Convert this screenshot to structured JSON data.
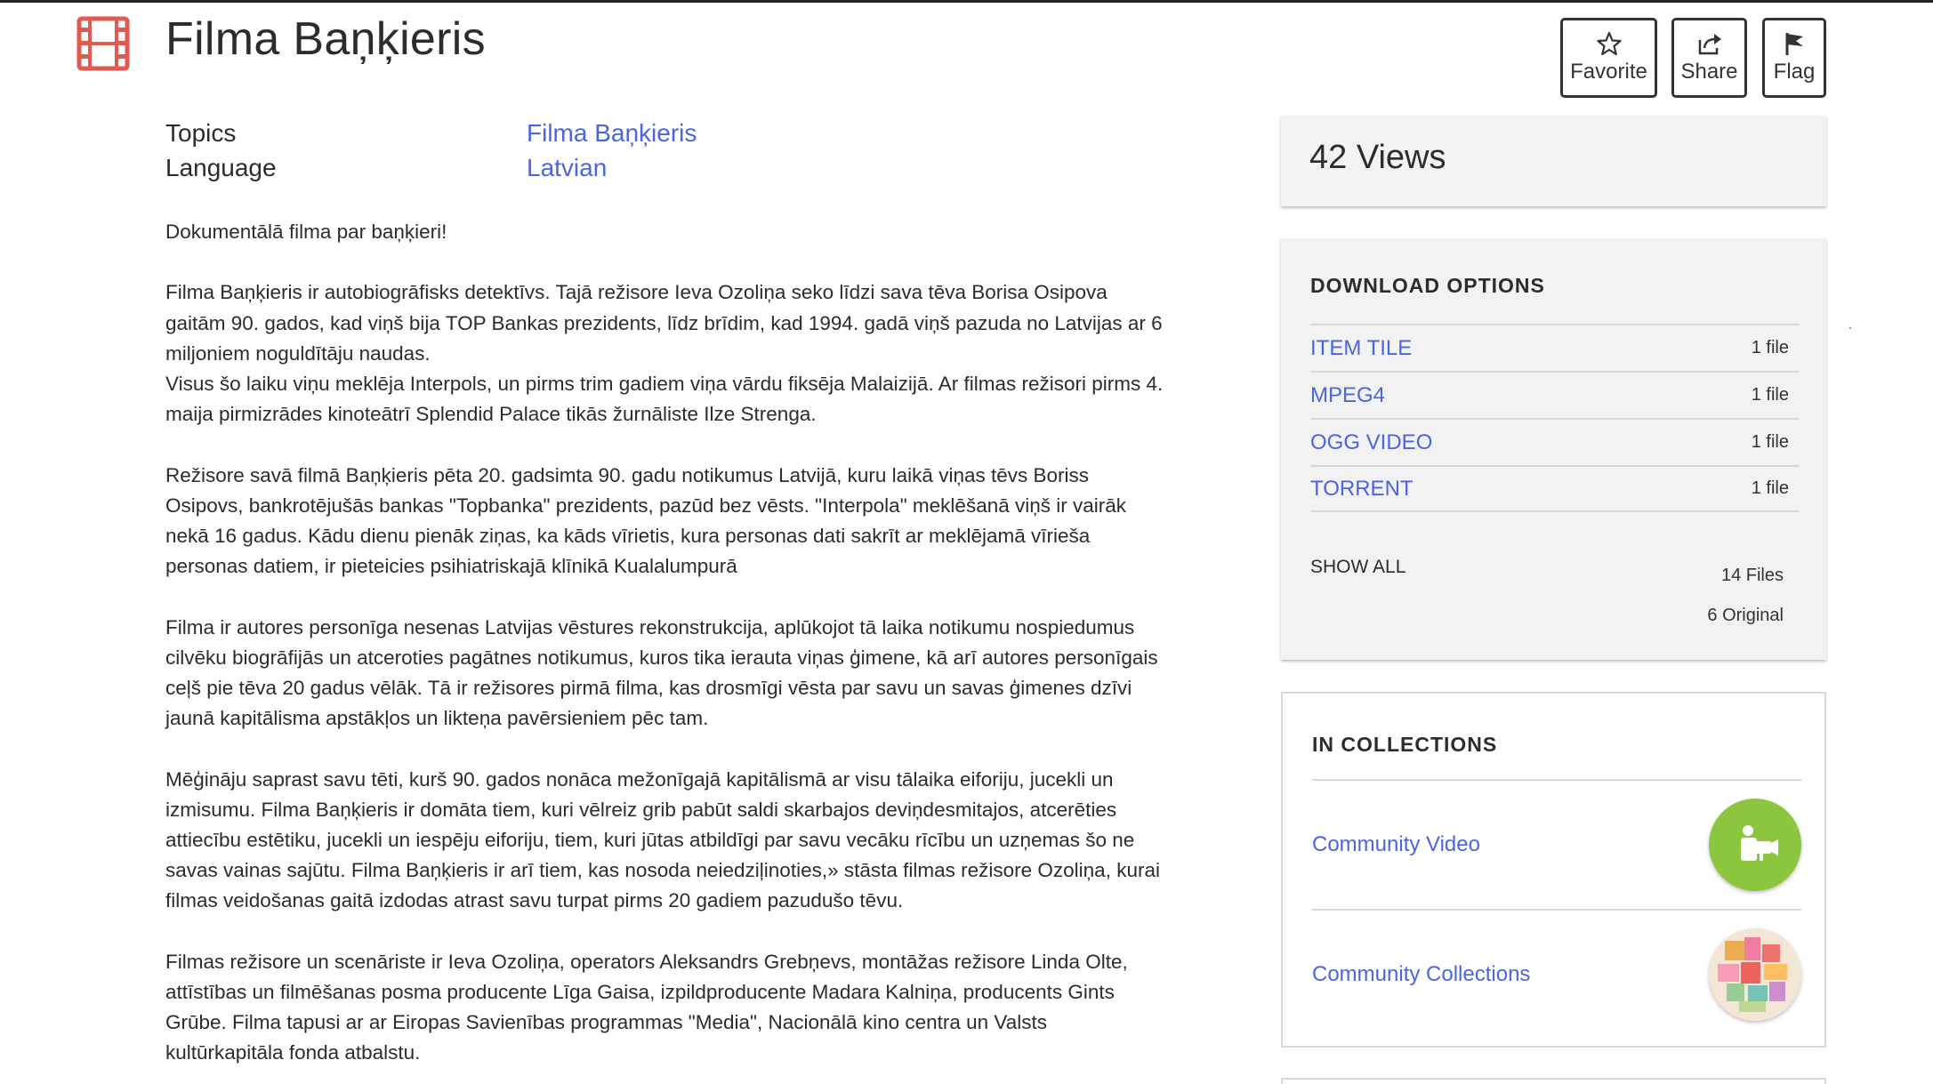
{
  "item": {
    "title": "Filma Baņķieris",
    "media_icon": "film-icon",
    "accent_color": "#e05a4f"
  },
  "actions": {
    "favorite_label": "Favorite",
    "share_label": "Share",
    "flag_label": "Flag"
  },
  "metadata": [
    {
      "key": "Topics",
      "value": "Filma Baņķieris"
    },
    {
      "key": "Language",
      "value": "Latvian"
    }
  ],
  "description": [
    "Dokumentālā filma par baņķieri!",
    "Filma Baņķieris ir autobiogrāfisks detektīvs. Tajā režisore Ieva Ozoliņa seko līdzi sava tēva Borisa Osipova\ngaitām 90. gados, kad viņš bija TOP Bankas prezidents, līdz brīdim, kad 1994. gadā viņš pazuda no Latvijas ar 6\nmiljoniem noguldītāju naudas.\nVisus šo laiku viņu meklēja Interpols, un pirms trim gadiem viņa vārdu fiksēja Malaizijā. Ar filmas režisori pirms 4.\nmaija pirmizrādes kinoteātrī Splendid Palace tikās žurnāliste Ilze Strenga.",
    "Režisore savā filmā Baņķieris pēta 20. gadsimta 90. gadu notikumus Latvijā, kuru laikā viņas tēvs Boriss\nOsipovs, bankrotējušās bankas \"Topbanka\" prezidents, pazūd bez vēsts. \"Interpola\" meklēšanā viņš ir vairāk\nnekā 16 gadus. Kādu dienu pienāk ziņas, ka kāds vīrietis, kura personas dati sakrīt ar meklējamā vīrieša\npersonas datiem, ir pieteicies psihiatriskajā klīnikā Kualalumpurā",
    "Filma ir autores personīga nesenas Latvijas vēstures rekonstrukcija, aplūkojot tā laika notikumu nospiedumus\ncilvēku biogrāfijās un atceroties pagātnes notikumus, kuros tika ierauta viņas ģimene, kā arī autores personīgais\nceļš pie tēva 20 gadus vēlāk. Tā ir režisores pirmā filma, kas drosmīgi vēsta par savu un savas ģimenes dzīvi\njaunā kapitālisma apstākļos un likteņa pavērsieniem pēc tam.",
    "Mēģināju saprast savu tēti, kurš 90. gados nonāca mežonīgajā kapitālismā ar visu tālaika eiforiju, jucekli un\nizmisumu. Filma Baņķieris ir domāta tiem, kuri vēlreiz grib pabūt saldi skarbajos deviņdesmitajos, atcerēties\nattiecību estētiku, jucekli un iespēju eiforiju, tiem, kuri jūtas atbildīgi par savu vecāku rīcību un uzņemas šo ne\nsavas vainas sajūtu. Filma Baņķieris ir arī tiem, kas nosoda neiedziļinoties,» stāsta filmas režisore Ozoliņa, kurai\nfilmas veidošanas gaitā izdodas atrast savu turpat pirms 20 gadiem pazudušo tēvu.",
    "Filmas režisore un scenāriste ir Ieva Ozoliņa, operators Aleksandrs Grebņevs, montāžas režisore Linda Olte,\nattīstības un filmēšanas posma producente Līga Gaisa, izpildproducente Madara Kalniņa, producents Gints\nGrūbe. Filma tapusi ar ar Eiropas Savienības programmas \"Media\", Nacionālā kino centra un Valsts\nkultūrkapitāla fonda atbalstu."
  ],
  "views": {
    "text": "42 Views"
  },
  "downloads": {
    "heading": "DOWNLOAD OPTIONS",
    "options": [
      {
        "name": "ITEM TILE",
        "count": "1 file"
      },
      {
        "name": "MPEG4",
        "count": "1 file"
      },
      {
        "name": "OGG VIDEO",
        "count": "1 file"
      },
      {
        "name": "TORRENT",
        "count": "1 file"
      }
    ],
    "show_all": "SHOW ALL",
    "files_total": "14 Files",
    "files_original": "6 Original"
  },
  "collections": {
    "heading": "IN COLLECTIONS",
    "items": [
      {
        "name": "Community Video",
        "thumb": "community-video-thumb"
      },
      {
        "name": "Community Collections",
        "thumb": "community-collections-thumb"
      }
    ]
  }
}
